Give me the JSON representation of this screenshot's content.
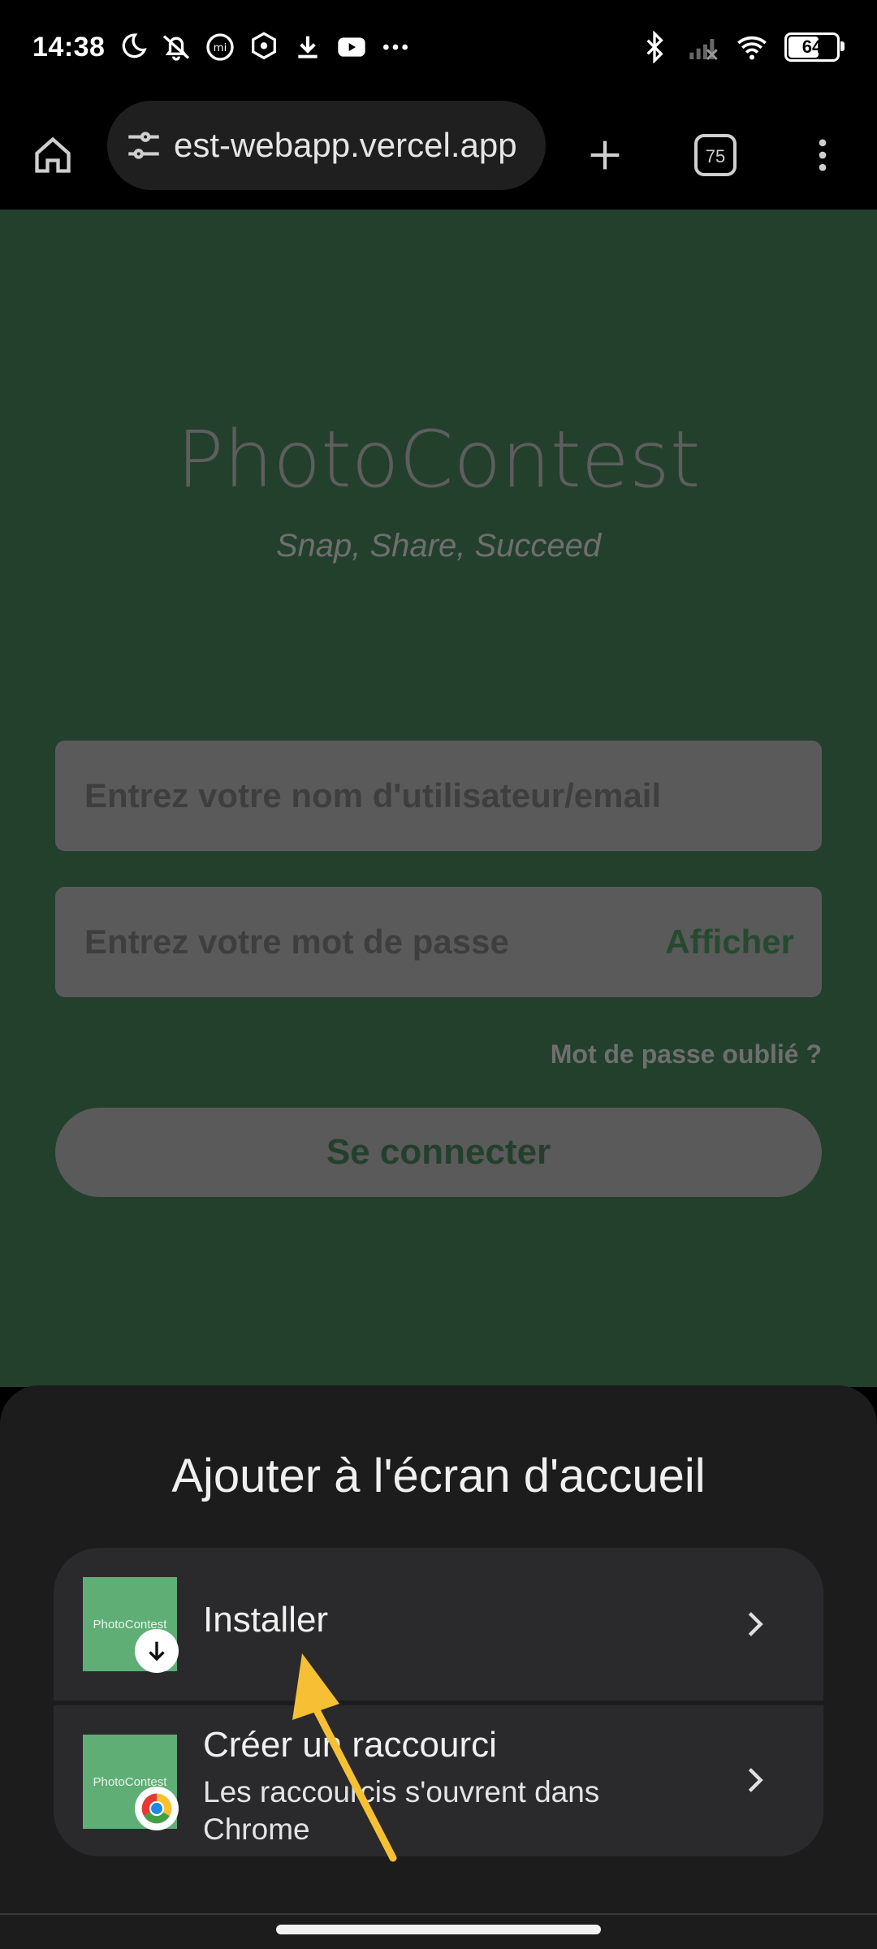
{
  "status_bar": {
    "time": "14:38",
    "battery": "64",
    "icons": [
      "moon-icon",
      "alarm-off-icon",
      "mi-icon",
      "shield-icon",
      "download-icon",
      "youtube-icon",
      "more-icon",
      "bluetooth-icon",
      "signal-icon",
      "wifi-icon",
      "battery-icon"
    ]
  },
  "browser": {
    "url": "est-webapp.vercel.app",
    "tab_count": "75"
  },
  "page": {
    "brand": "PhotoContest",
    "tagline": "Snap, Share, Succeed",
    "username_placeholder": "Entrez votre nom d'utilisateur/email",
    "password_placeholder": "Entrez votre mot de passe",
    "show_password": "Afficher",
    "forgot_password": "Mot de passe oublié ?",
    "login_button": "Se connecter"
  },
  "sheet": {
    "title": "Ajouter à l'écran d'accueil",
    "options": [
      {
        "label": "Installer",
        "thumb_text": "PhotoContest"
      },
      {
        "label": "Créer un raccourci",
        "sub": "Les raccourcis s'ouvrent dans Chrome",
        "thumb_text": "PhotoContest"
      }
    ]
  },
  "colors": {
    "page_bg": "#23402c",
    "sheet_bg": "#1c1c1d",
    "option_bg": "#2a2a2c",
    "thumb_green": "#5fae75",
    "annotation_arrow": "#f5c033"
  }
}
